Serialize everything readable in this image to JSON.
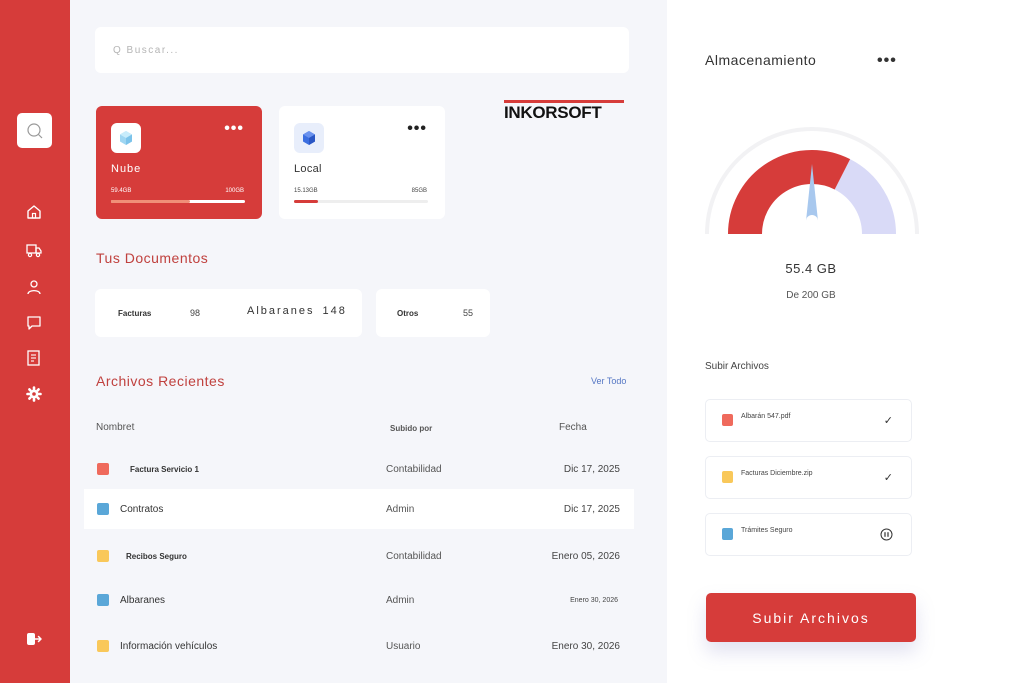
{
  "colors": {
    "accent": "#d63c3a",
    "accent_light": "#f08f78",
    "gauge_bg": "#d9daf7",
    "link": "#5577c4",
    "folder_blue": "#5aa7d8",
    "folder_yellow": "#f9c85a",
    "pdf_red": "#ef6a5c"
  },
  "sidebar": {
    "icons": [
      "search-icon",
      "home-icon",
      "truck-icon",
      "user-icon",
      "chat-icon",
      "document-icon",
      "gear-icon",
      "logout-icon"
    ]
  },
  "search": {
    "placeholder": "Q Buscar..."
  },
  "storage_cards": [
    {
      "name": "Nube",
      "used": "59.4GB",
      "total": "100GB",
      "progress": 0.59
    },
    {
      "name": "Local",
      "used": "15.13GB",
      "total": "85GB",
      "progress": 0.18
    }
  ],
  "logo": {
    "text": "INKORSOFT"
  },
  "documents": {
    "title": "Tus Documentos",
    "items": [
      {
        "label": "Facturas",
        "count": "98"
      },
      {
        "label": "Albaranes",
        "count": "148"
      },
      {
        "label": "Otros",
        "count": "55"
      }
    ]
  },
  "recent": {
    "title": "Archivos Recientes",
    "see_all": "Ver Todo",
    "headers": {
      "name": "Nombret",
      "uploaded_by": "Subido por",
      "date": "Fecha"
    },
    "rows": [
      {
        "name": "Factura Servicio 1",
        "by": "Contabilidad",
        "date": "Dic 17, 2025",
        "icon": "pdf-icon"
      },
      {
        "name": "Contratos",
        "by": "Admin",
        "date": "Dic 17, 2025",
        "icon": "folder-icon"
      },
      {
        "name": "Recibos Seguro",
        "by": "Contabilidad",
        "date": "Enero 05, 2026",
        "icon": "folder-icon"
      },
      {
        "name": "Albaranes",
        "by": "Admin",
        "date": "Enero 30, 2026",
        "icon": "folder-icon"
      },
      {
        "name": "Información vehículos",
        "by": "Usuario",
        "date": "Enero 30, 2026",
        "icon": "folder-icon"
      }
    ]
  },
  "storage": {
    "title": "Almacenamiento",
    "used": "55.4 GB",
    "total": "De 200 GB",
    "gauge_used_fraction": 0.65,
    "gauge_secondary_fraction": 0.85
  },
  "uploads": {
    "title": "Subir Archivos",
    "items": [
      {
        "name": "Albarán 547.pdf",
        "status": "done"
      },
      {
        "name": "Facturas Diciembre.zip",
        "status": "done"
      },
      {
        "name": "Trámites Seguro",
        "status": "paused"
      }
    ],
    "button": "Subir Archivos"
  }
}
